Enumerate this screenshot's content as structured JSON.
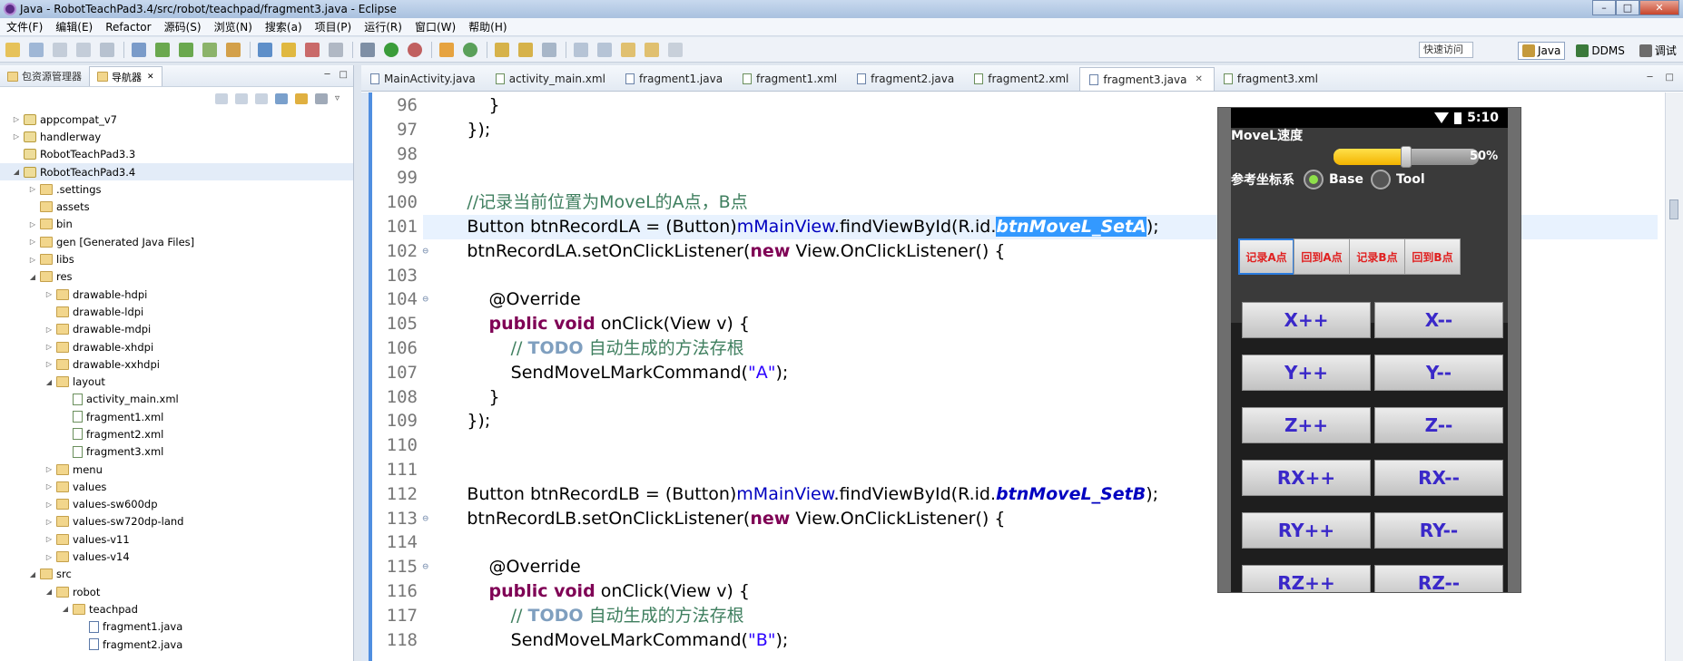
{
  "window": {
    "title": "Java - RobotTeachPad3.4/src/robot/teachpad/fragment3.java - Eclipse",
    "min": "–",
    "max": "□",
    "close": "✕"
  },
  "menu": [
    "文件(F)",
    "编辑(E)",
    "Refactor",
    "源码(S)",
    "浏览(N)",
    "搜索(a)",
    "项目(P)",
    "运行(R)",
    "窗口(W)",
    "帮助(H)"
  ],
  "toolbar": {
    "quick_access": "快速访问",
    "perspectives": [
      {
        "label": "Java",
        "active": true
      },
      {
        "label": "DDMS",
        "active": false
      },
      {
        "label": "调试",
        "active": false
      }
    ]
  },
  "left_panel": {
    "tabs": [
      {
        "label": "包资源管理器",
        "active": false
      },
      {
        "label": "导航器",
        "active": true,
        "close": "✕"
      }
    ],
    "tree": [
      {
        "label": "appcompat_v7",
        "depth": 0,
        "arrow": "▷",
        "icon": "project"
      },
      {
        "label": "handlerway",
        "depth": 0,
        "arrow": "▷",
        "icon": "project"
      },
      {
        "label": "RobotTeachPad3.3",
        "depth": 0,
        "arrow": "",
        "icon": "project"
      },
      {
        "label": "RobotTeachPad3.4",
        "depth": 0,
        "arrow": "◢",
        "icon": "project",
        "selected": true
      },
      {
        "label": ".settings",
        "depth": 1,
        "arrow": "▷",
        "icon": "folder"
      },
      {
        "label": "assets",
        "depth": 1,
        "arrow": "",
        "icon": "folder"
      },
      {
        "label": "bin",
        "depth": 1,
        "arrow": "▷",
        "icon": "folder"
      },
      {
        "label": "gen [Generated Java Files]",
        "depth": 1,
        "arrow": "▷",
        "icon": "folder"
      },
      {
        "label": "libs",
        "depth": 1,
        "arrow": "▷",
        "icon": "folder"
      },
      {
        "label": "res",
        "depth": 1,
        "arrow": "◢",
        "icon": "folder"
      },
      {
        "label": "drawable-hdpi",
        "depth": 2,
        "arrow": "▷",
        "icon": "folder"
      },
      {
        "label": "drawable-ldpi",
        "depth": 2,
        "arrow": "",
        "icon": "folder"
      },
      {
        "label": "drawable-mdpi",
        "depth": 2,
        "arrow": "▷",
        "icon": "folder"
      },
      {
        "label": "drawable-xhdpi",
        "depth": 2,
        "arrow": "▷",
        "icon": "folder"
      },
      {
        "label": "drawable-xxhdpi",
        "depth": 2,
        "arrow": "▷",
        "icon": "folder"
      },
      {
        "label": "layout",
        "depth": 2,
        "arrow": "◢",
        "icon": "folder"
      },
      {
        "label": "activity_main.xml",
        "depth": 3,
        "arrow": "",
        "icon": "xml"
      },
      {
        "label": "fragment1.xml",
        "depth": 3,
        "arrow": "",
        "icon": "xml"
      },
      {
        "label": "fragment2.xml",
        "depth": 3,
        "arrow": "",
        "icon": "xml"
      },
      {
        "label": "fragment3.xml",
        "depth": 3,
        "arrow": "",
        "icon": "xml"
      },
      {
        "label": "menu",
        "depth": 2,
        "arrow": "▷",
        "icon": "folder"
      },
      {
        "label": "values",
        "depth": 2,
        "arrow": "▷",
        "icon": "folder"
      },
      {
        "label": "values-sw600dp",
        "depth": 2,
        "arrow": "▷",
        "icon": "folder"
      },
      {
        "label": "values-sw720dp-land",
        "depth": 2,
        "arrow": "▷",
        "icon": "folder"
      },
      {
        "label": "values-v11",
        "depth": 2,
        "arrow": "▷",
        "icon": "folder"
      },
      {
        "label": "values-v14",
        "depth": 2,
        "arrow": "▷",
        "icon": "folder"
      },
      {
        "label": "src",
        "depth": 1,
        "arrow": "◢",
        "icon": "folder"
      },
      {
        "label": "robot",
        "depth": 2,
        "arrow": "◢",
        "icon": "folder"
      },
      {
        "label": "teachpad",
        "depth": 3,
        "arrow": "◢",
        "icon": "folder"
      },
      {
        "label": "fragment1.java",
        "depth": 4,
        "arrow": "",
        "icon": "java"
      },
      {
        "label": "fragment2.java",
        "depth": 4,
        "arrow": "",
        "icon": "java"
      }
    ]
  },
  "editor": {
    "tabs": [
      {
        "label": "MainActivity.java",
        "active": false
      },
      {
        "label": "activity_main.xml",
        "active": false
      },
      {
        "label": "fragment1.java",
        "active": false
      },
      {
        "label": "fragment1.xml",
        "active": false
      },
      {
        "label": "fragment2.java",
        "active": false
      },
      {
        "label": "fragment2.xml",
        "active": false
      },
      {
        "label": "fragment3.java",
        "active": true
      },
      {
        "label": "fragment3.xml",
        "active": false
      }
    ],
    "tab_close": "✕",
    "lines": [
      {
        "n": "96",
        "fold": "",
        "parts": [
          [
            "",
            "            }"
          ]
        ]
      },
      {
        "n": "97",
        "fold": "",
        "parts": [
          [
            "",
            "        });"
          ]
        ]
      },
      {
        "n": "98",
        "fold": "",
        "parts": [
          [
            "",
            ""
          ]
        ]
      },
      {
        "n": "99",
        "fold": "",
        "parts": [
          [
            "",
            ""
          ]
        ]
      },
      {
        "n": "100",
        "fold": "",
        "parts": [
          [
            "",
            "        "
          ],
          [
            "cmt",
            "//记录当前位置为MoveL的A点，B点"
          ]
        ]
      },
      {
        "n": "101",
        "fold": "",
        "hl": true,
        "parts": [
          [
            "",
            "        Button btnRecordLA = (Button)"
          ],
          [
            "fld",
            "mMainView"
          ],
          [
            "",
            ".findViewById(R.id."
          ],
          [
            "idref sel",
            "btnMoveL_SetA"
          ],
          [
            "",
            ");"
          ]
        ]
      },
      {
        "n": "102",
        "fold": "⊖",
        "parts": [
          [
            "",
            "        btnRecordLA.setOnClickListener("
          ],
          [
            "kw",
            "new"
          ],
          [
            "",
            " View.OnClickListener() {"
          ]
        ]
      },
      {
        "n": "103",
        "fold": "",
        "parts": [
          [
            "",
            ""
          ]
        ]
      },
      {
        "n": "104",
        "fold": "⊖",
        "parts": [
          [
            "",
            "            @Override"
          ]
        ]
      },
      {
        "n": "105",
        "fold": "",
        "parts": [
          [
            "",
            "            "
          ],
          [
            "kw",
            "public void"
          ],
          [
            "",
            " onClick(View v) {"
          ]
        ]
      },
      {
        "n": "106",
        "fold": "",
        "parts": [
          [
            "",
            "                "
          ],
          [
            "cmt",
            "// "
          ],
          [
            "todo",
            "TODO"
          ],
          [
            "cmt",
            " 自动生成的方法存根"
          ]
        ]
      },
      {
        "n": "107",
        "fold": "",
        "parts": [
          [
            "",
            "                SendMoveLMarkCommand("
          ],
          [
            "str",
            "\"A\""
          ],
          [
            "",
            ");"
          ]
        ]
      },
      {
        "n": "108",
        "fold": "",
        "parts": [
          [
            "",
            "            }"
          ]
        ]
      },
      {
        "n": "109",
        "fold": "",
        "parts": [
          [
            "",
            "        });"
          ]
        ]
      },
      {
        "n": "110",
        "fold": "",
        "parts": [
          [
            "",
            ""
          ]
        ]
      },
      {
        "n": "111",
        "fold": "",
        "parts": [
          [
            "",
            ""
          ]
        ]
      },
      {
        "n": "112",
        "fold": "",
        "parts": [
          [
            "",
            "        Button btnRecordLB = (Button)"
          ],
          [
            "fld",
            "mMainView"
          ],
          [
            "",
            ".findViewById(R.id."
          ],
          [
            "idref",
            "btnMoveL_SetB"
          ],
          [
            "",
            ");"
          ]
        ]
      },
      {
        "n": "113",
        "fold": "⊖",
        "parts": [
          [
            "",
            "        btnRecordLB.setOnClickListener("
          ],
          [
            "kw",
            "new"
          ],
          [
            "",
            " View.OnClickListener() {"
          ]
        ]
      },
      {
        "n": "114",
        "fold": "",
        "parts": [
          [
            "",
            ""
          ]
        ]
      },
      {
        "n": "115",
        "fold": "⊖",
        "parts": [
          [
            "",
            "            @Override"
          ]
        ]
      },
      {
        "n": "116",
        "fold": "",
        "parts": [
          [
            "",
            "            "
          ],
          [
            "kw",
            "public void"
          ],
          [
            "",
            " onClick(View v) {"
          ]
        ]
      },
      {
        "n": "117",
        "fold": "",
        "parts": [
          [
            "",
            "                "
          ],
          [
            "cmt",
            "// "
          ],
          [
            "todo",
            "TODO"
          ],
          [
            "cmt",
            " 自动生成的方法存根"
          ]
        ]
      },
      {
        "n": "118",
        "fold": "",
        "parts": [
          [
            "",
            "                SendMoveLMarkCommand("
          ],
          [
            "str",
            "\"B\""
          ],
          [
            "",
            ");"
          ]
        ]
      }
    ]
  },
  "phone": {
    "time": "5:10",
    "speed_label": "MoveL速度",
    "speed_pct": "50%",
    "speed_value": 0.5,
    "coord_label": "参考坐标系",
    "radio_base": "Base",
    "radio_tool": "Tool",
    "small_buttons": [
      "记录A点",
      "回到A点",
      "记录B点",
      "回到B点"
    ],
    "big_buttons": [
      [
        "X++",
        "X--"
      ],
      [
        "Y++",
        "Y--"
      ],
      [
        "Z++",
        "Z--"
      ],
      [
        "RX++",
        "RX--"
      ],
      [
        "RY++",
        "RY--"
      ],
      [
        "RZ++",
        "RZ--"
      ]
    ]
  },
  "colors": {
    "keyword": "#7f0055",
    "field": "#0000c0",
    "string": "#2a00ff",
    "comment": "#3f7f5f",
    "selection": "#3399ff"
  }
}
